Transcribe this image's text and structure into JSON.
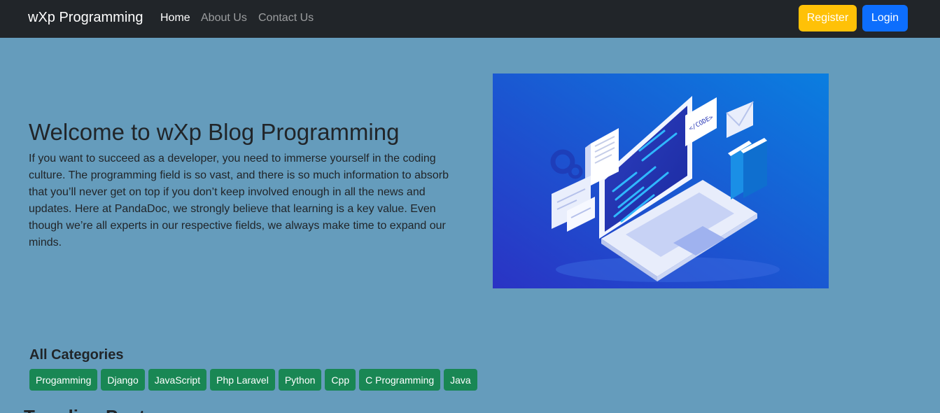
{
  "navbar": {
    "brand": "wXp Programming",
    "links": [
      "Home",
      "About Us",
      "Contact Us"
    ],
    "register_label": "Register",
    "login_label": "Login"
  },
  "hero": {
    "title": "Welcome to wXp Blog Programming",
    "text": "If you want to succeed as a developer, you need to immerse yourself in the coding culture. The programming field is so vast, and there is so much information to absorb that you’ll never get on top if you don’t keep involved enough in all the news and updates. Here at PandaDoc, we strongly believe that learning is a key value. Even though we’re all experts in our respective fields, we always make time to expand our minds.",
    "image_code_label": "</CODE>"
  },
  "categories": {
    "title": "All Categories",
    "tags": [
      "Progamming",
      "Django",
      "JavaScript",
      "Php Laravel",
      "Python",
      "Cpp",
      "C Programming",
      "Java"
    ]
  },
  "next_section": {
    "partial_heading": "Trending Posts"
  },
  "colors": {
    "page_bg": "#659cbc",
    "navbar_bg": "#212529",
    "register": "#ffc107",
    "login": "#0d6efd",
    "tag": "#198754"
  }
}
